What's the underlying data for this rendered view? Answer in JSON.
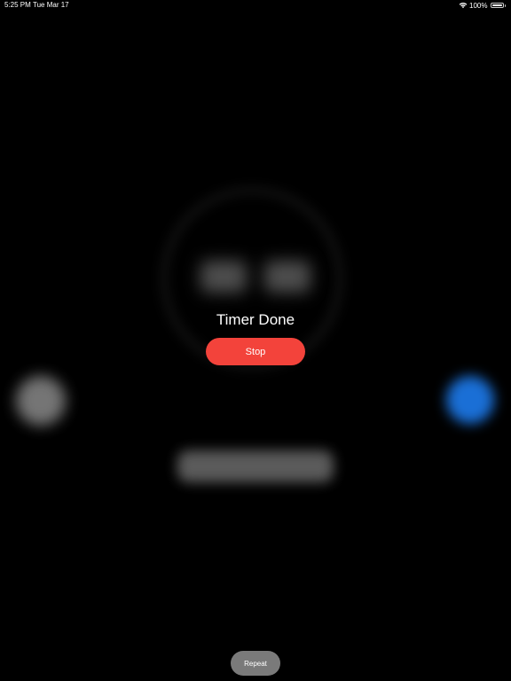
{
  "status_bar": {
    "time": "5:25 PM",
    "date": "Tue Mar 17",
    "battery": "100%",
    "icons": [
      "wifi-icon",
      "battery-icon"
    ]
  },
  "alert": {
    "title": "Timer Done",
    "stop_label": "Stop"
  },
  "footer": {
    "repeat_label": "Repeat"
  },
  "colors": {
    "background": "#000000",
    "stop_button": "#f3433b",
    "blurred_pause_button": "#1a6fd6",
    "repeat_button": "#7a7a7a"
  }
}
